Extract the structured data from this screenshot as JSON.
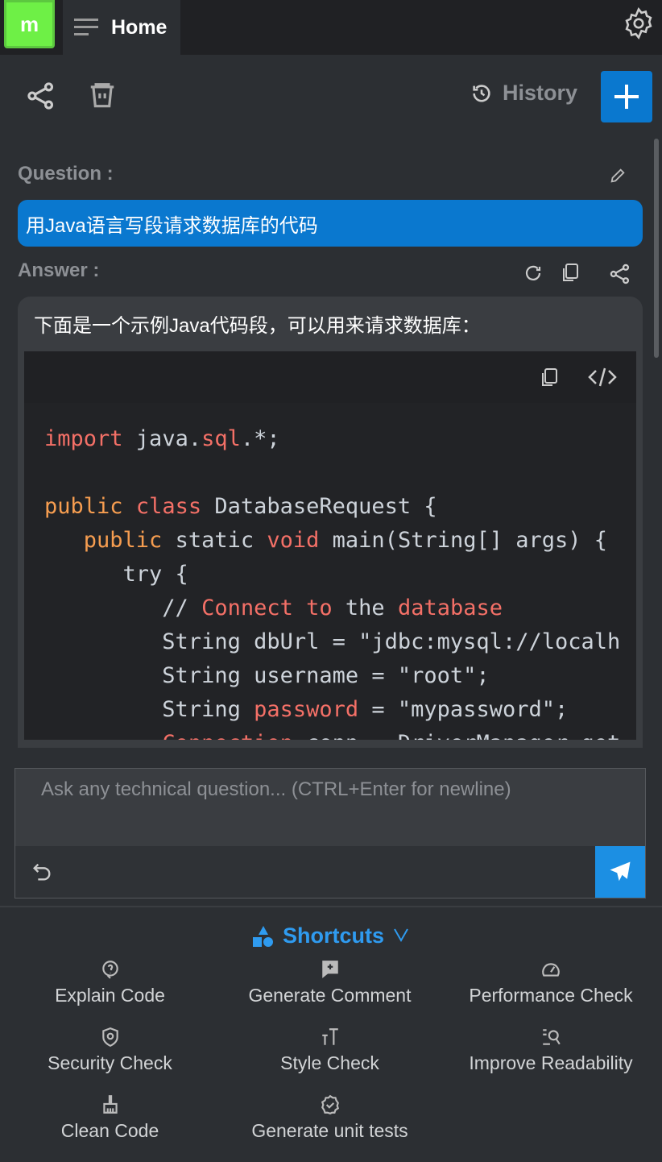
{
  "header": {
    "logo": "m",
    "tab_label": "Home",
    "settings_icon": "gear-icon"
  },
  "toolbar": {
    "history_label": "History",
    "new_icon": "plus-icon"
  },
  "question": {
    "label": "Question :",
    "text": "用Java语言写段请求数据库的代码"
  },
  "answer": {
    "label": "Answer :",
    "intro": "下面是一个示例Java代码段，可以用来请求数据库："
  },
  "code": {
    "lines": [
      [
        {
          "t": "import",
          "c": "kw"
        },
        {
          "t": " java."
        },
        {
          "t": "sql",
          "c": "kw"
        },
        {
          "t": ".*;"
        }
      ],
      [],
      [
        {
          "t": "public",
          "c": "ty"
        },
        {
          "t": " "
        },
        {
          "t": "class",
          "c": "kw"
        },
        {
          "t": " DatabaseRequest {"
        }
      ],
      [
        {
          "t": "   "
        },
        {
          "t": "public",
          "c": "ty"
        },
        {
          "t": " static "
        },
        {
          "t": "void",
          "c": "kw"
        },
        {
          "t": " main(String[] args) {"
        }
      ],
      [
        {
          "t": "      try {"
        }
      ],
      [
        {
          "t": "         // "
        },
        {
          "t": "Connect",
          "c": "kw"
        },
        {
          "t": " "
        },
        {
          "t": "to",
          "c": "kw"
        },
        {
          "t": " the "
        },
        {
          "t": "database",
          "c": "kw"
        }
      ],
      [
        {
          "t": "         String dbUrl = \"jdbc:mysql://localh"
        }
      ],
      [
        {
          "t": "         String username = \"root\";"
        }
      ],
      [
        {
          "t": "         String "
        },
        {
          "t": "password",
          "c": "kw"
        },
        {
          "t": " = \"mypassword\";"
        }
      ],
      [
        {
          "t": "         "
        },
        {
          "t": "Connection",
          "c": "kw"
        },
        {
          "t": " conn = DriverManager.get"
        }
      ]
    ]
  },
  "input": {
    "placeholder": "Ask any technical question... (CTRL+Enter for newline)"
  },
  "shortcuts": {
    "title": "Shortcuts",
    "items": [
      {
        "label": "Explain Code",
        "icon": "question-icon"
      },
      {
        "label": "Generate Comment",
        "icon": "comment-plus-icon"
      },
      {
        "label": "Performance Check",
        "icon": "gauge-icon"
      },
      {
        "label": "Security Check",
        "icon": "shield-icon"
      },
      {
        "label": "Style Check",
        "icon": "text-size-icon"
      },
      {
        "label": "Improve Readability",
        "icon": "list-search-icon"
      },
      {
        "label": "Clean Code",
        "icon": "broom-icon"
      },
      {
        "label": "Generate unit tests",
        "icon": "badge-check-icon"
      }
    ]
  },
  "colors": {
    "accent": "#0a78cf",
    "logo": "#6ef046",
    "keyword": "#f47067",
    "type": "#f69d50"
  }
}
